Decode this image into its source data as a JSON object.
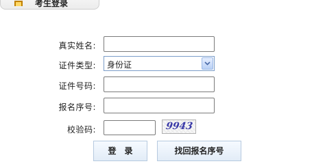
{
  "header": {
    "tab_title": "考生登录"
  },
  "form": {
    "name_label": "真实姓名:",
    "id_type_label": "证件类型:",
    "id_type_value": "身份证",
    "id_number_label": "证件号码:",
    "reg_number_label": "报名序号:",
    "captcha_label": "校验码:",
    "captcha_image_text": "9943"
  },
  "buttons": {
    "login_label": "登录",
    "recover_label": "找回报名序号"
  }
}
